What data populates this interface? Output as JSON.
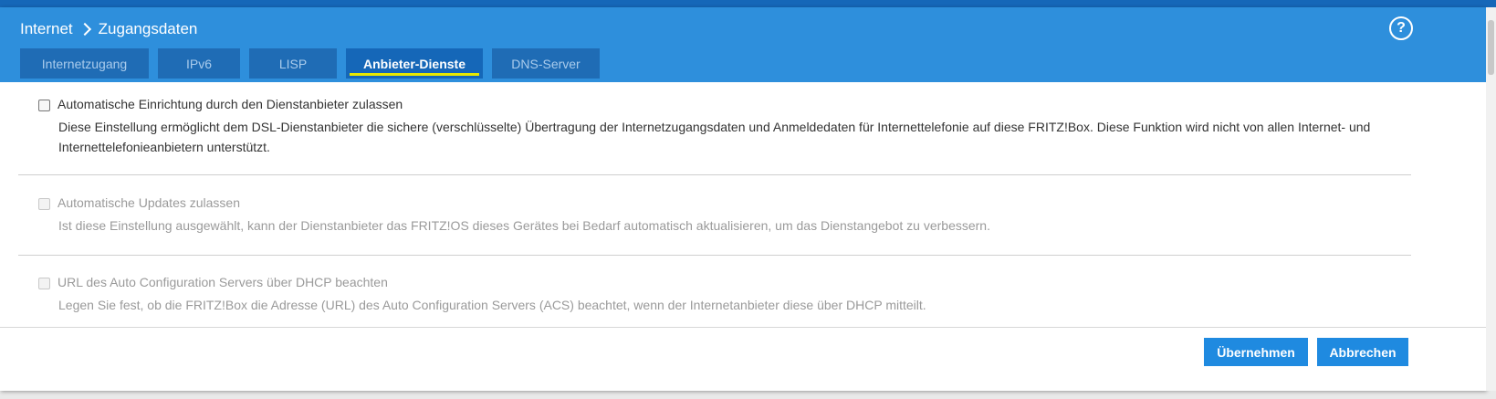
{
  "header": {
    "breadcrumb": [
      "Internet",
      "Zugangsdaten"
    ],
    "help_symbol": "?"
  },
  "tabs": [
    {
      "label": "Internetzugang",
      "active": false
    },
    {
      "label": "IPv6",
      "active": false
    },
    {
      "label": "LISP",
      "active": false
    },
    {
      "label": "Anbieter-Dienste",
      "active": true
    },
    {
      "label": "DNS-Server",
      "active": false
    }
  ],
  "options": [
    {
      "label": "Automatische Einrichtung durch den Dienstanbieter zulassen",
      "description": "Diese Einstellung ermöglicht dem DSL-Dienstanbieter die sichere (verschlüsselte) Übertragung der Internetzugangsdaten und Anmeldedaten für Internettelefonie auf diese FRITZ!Box. Diese Funktion wird nicht von allen Internet- und Internettelefonieanbietern unterstützt.",
      "checked": false,
      "enabled": true
    },
    {
      "label": "Automatische Updates zulassen",
      "description": "Ist diese Einstellung ausgewählt, kann der Dienstanbieter das FRITZ!OS dieses Gerätes bei Bedarf automatisch aktualisieren, um das Dienstangebot zu verbessern.",
      "checked": false,
      "enabled": false
    },
    {
      "label": "URL des Auto Configuration Servers über DHCP beachten",
      "description": "Legen Sie fest, ob die FRITZ!Box die Adresse (URL) des Auto Configuration Servers (ACS) beachtet, wenn der Internetanbieter diese über DHCP mitteilt.",
      "checked": false,
      "enabled": false
    }
  ],
  "buttons": {
    "apply": "Übernehmen",
    "cancel": "Abbrechen"
  },
  "colors": {
    "header": "#2e8fdc",
    "tab_bg": "#1f6cb5",
    "tab_active": "#1567b8",
    "tab_underline": "#e7e900",
    "button": "#1f8ae0"
  }
}
